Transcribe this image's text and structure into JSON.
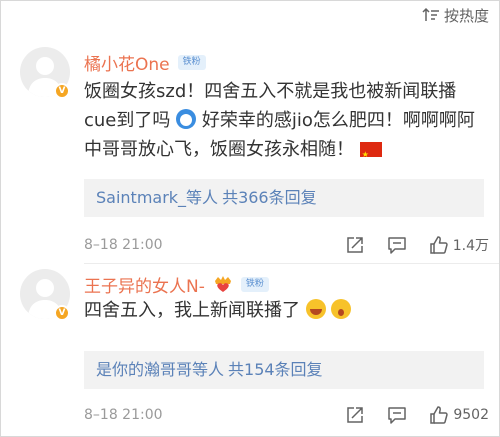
{
  "sort": {
    "label": "按热度"
  },
  "comments": [
    {
      "username": "橘小花One",
      "badge": "铁粉",
      "content_a": "饭圈女孩szd！四舍五入不就是我也被新闻联播cue到了吗",
      "content_b": "好荣幸的感jio怎么肥四！啊啊啊阿中哥哥放心飞，饭圈女孩永相随！",
      "reply_users": "Saintmark_等人",
      "reply_count": "共366条回复",
      "timestamp": "8–18 21:00",
      "likes": "1.4万"
    },
    {
      "username": "王子异的女人N-",
      "badge": "铁粉",
      "content_a": "四舍五入，我上新闻联播了",
      "reply_users": "是你的瀚哥哥等人",
      "reply_count": "共154条回复",
      "timestamp": "8–18 21:00",
      "likes": "9502"
    }
  ],
  "colors": {
    "username": "#eb7350",
    "link": "#5b82b8",
    "meta": "#9a9a9a",
    "badge_bg": "#e4f0fb"
  },
  "icons": [
    "sort-icon",
    "avatar-placeholder-icon",
    "v-badge-icon",
    "doraemon-emoji-icon",
    "china-flag-icon",
    "crown-heart-icon",
    "laugh-emoji-icon",
    "shock-emoji-icon",
    "share-icon",
    "comment-icon",
    "like-icon"
  ]
}
